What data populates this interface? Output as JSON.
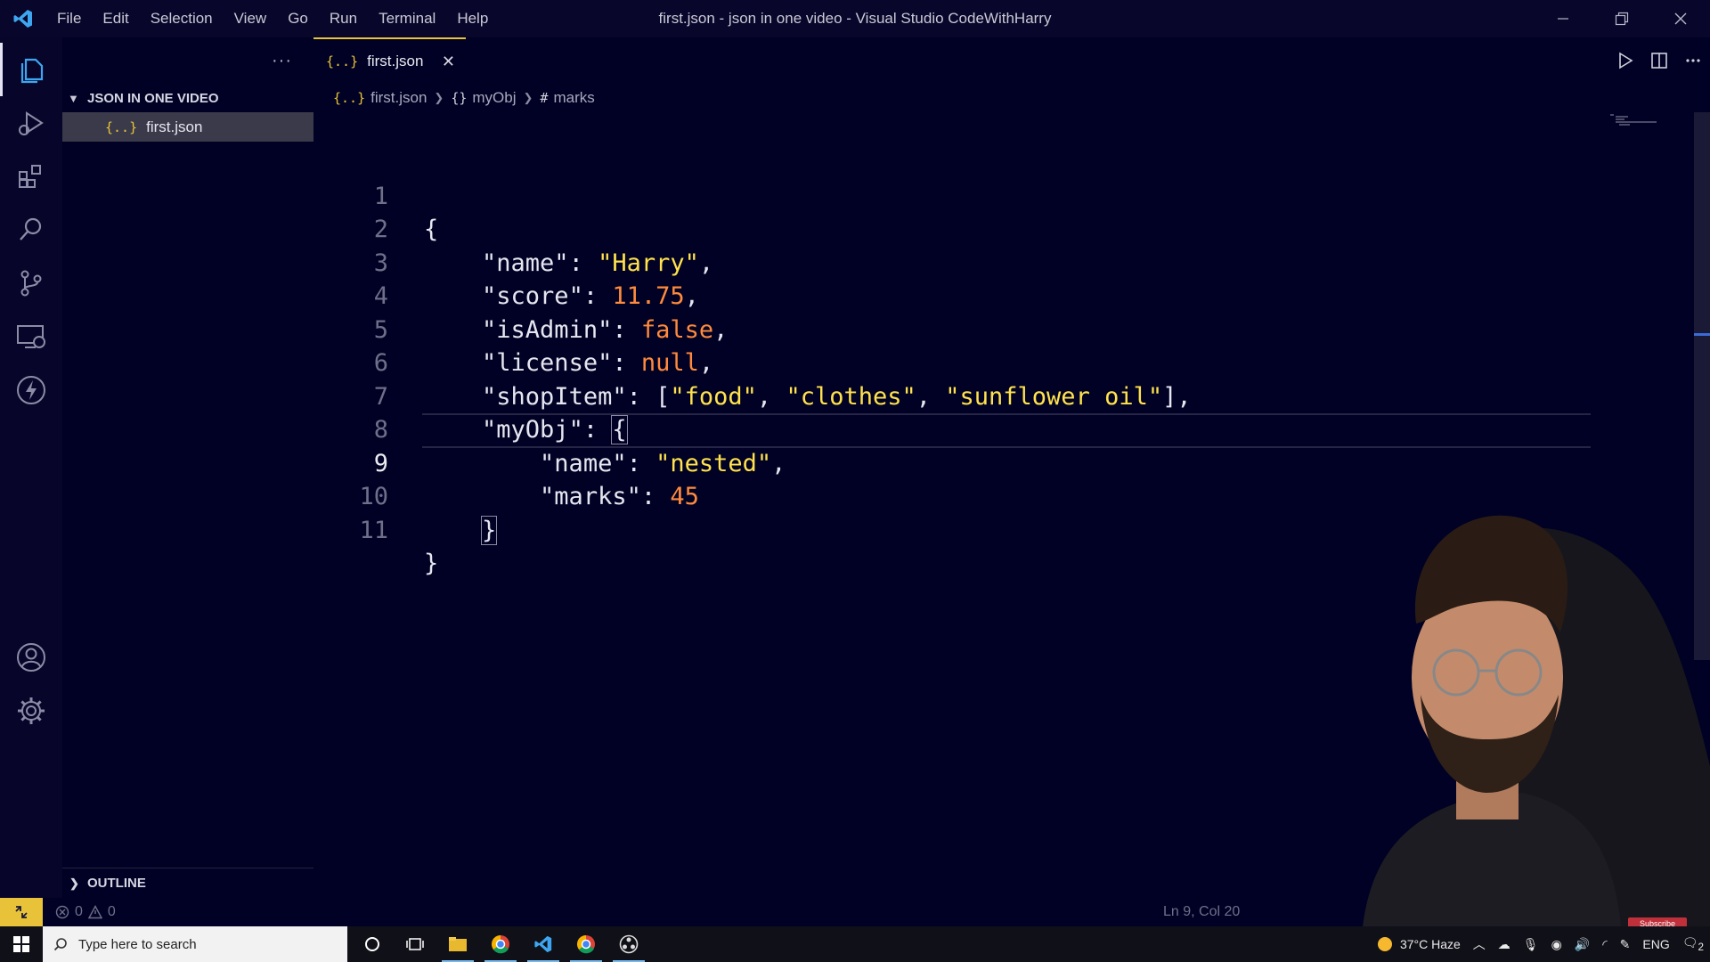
{
  "titlebar": {
    "menu": [
      "File",
      "Edit",
      "Selection",
      "View",
      "Go",
      "Run",
      "Terminal",
      "Help"
    ],
    "window_title": "first.json - json in one video - Visual Studio CodeWithHarry"
  },
  "sidebar": {
    "folder_name": "JSON IN ONE VIDEO",
    "file_icon": "{..}",
    "file_name": "first.json",
    "outline_label": "OUTLINE",
    "more_label": "···"
  },
  "tab": {
    "icon": "{..}",
    "label": "first.json",
    "close": "✕"
  },
  "breadcrumbs": {
    "file_icon": "{..}",
    "file": "first.json",
    "obj_icon": "{}",
    "obj": "myObj",
    "key_icon": "#",
    "key": "marks"
  },
  "code": {
    "line_numbers": [
      "1",
      "2",
      "3",
      "4",
      "5",
      "6",
      "7",
      "8",
      "9",
      "10",
      "11"
    ],
    "current_line": "9",
    "open_brace": "{",
    "close_brace": "}",
    "k_name": "\"name\"",
    "v_name": "\"Harry\"",
    "k_score": "\"score\"",
    "v_score": "11.75",
    "k_isAdmin": "\"isAdmin\"",
    "v_isAdmin": "false",
    "k_license": "\"license\"",
    "v_license": "null",
    "k_shopItem": "\"shopItem\"",
    "v_shop_1": "\"food\"",
    "v_shop_2": "\"clothes\"",
    "v_shop_3": "\"sunflower oil\"",
    "k_myObj": "\"myObj\"",
    "k_nested_name": "\"name\"",
    "v_nested_name": "\"nested\"",
    "k_marks": "\"marks\"",
    "v_marks": "45"
  },
  "statusbar": {
    "errors": "0",
    "warnings": "0",
    "position": "Ln 9, Col 20"
  },
  "taskbar": {
    "search_placeholder": "Type here to search",
    "weather": "37°C  Haze",
    "language": "ENG",
    "notif_count": "2"
  },
  "overlay": {
    "subscribe": "Subscribe"
  },
  "colors": {
    "background": "#000124",
    "string": "#ffe24d",
    "number": "#ff8a3d",
    "accent": "#e8c33a"
  }
}
